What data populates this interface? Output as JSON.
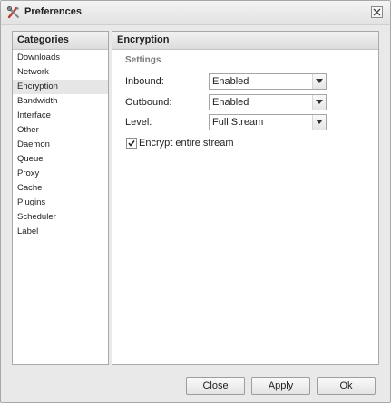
{
  "window": {
    "title": "Preferences",
    "app_icon": "deluge-tools-icon",
    "close_icon": "close-icon"
  },
  "sidebar": {
    "header": "Categories",
    "items": [
      {
        "label": "Downloads",
        "selected": false
      },
      {
        "label": "Network",
        "selected": false
      },
      {
        "label": "Encryption",
        "selected": true
      },
      {
        "label": "Bandwidth",
        "selected": false
      },
      {
        "label": "Interface",
        "selected": false
      },
      {
        "label": "Other",
        "selected": false
      },
      {
        "label": "Daemon",
        "selected": false
      },
      {
        "label": "Queue",
        "selected": false
      },
      {
        "label": "Proxy",
        "selected": false
      },
      {
        "label": "Cache",
        "selected": false
      },
      {
        "label": "Plugins",
        "selected": false
      },
      {
        "label": "Scheduler",
        "selected": false
      },
      {
        "label": "Label",
        "selected": false
      }
    ]
  },
  "main": {
    "header": "Encryption",
    "section_label": "Settings",
    "fields": {
      "inbound": {
        "label": "Inbound:",
        "value": "Enabled"
      },
      "outbound": {
        "label": "Outbound:",
        "value": "Enabled"
      },
      "level": {
        "label": "Level:",
        "value": "Full Stream"
      }
    },
    "encrypt_stream": {
      "label": "Encrypt entire stream",
      "checked": true
    }
  },
  "footer": {
    "close_label": "Close",
    "apply_label": "Apply",
    "ok_label": "Ok"
  }
}
